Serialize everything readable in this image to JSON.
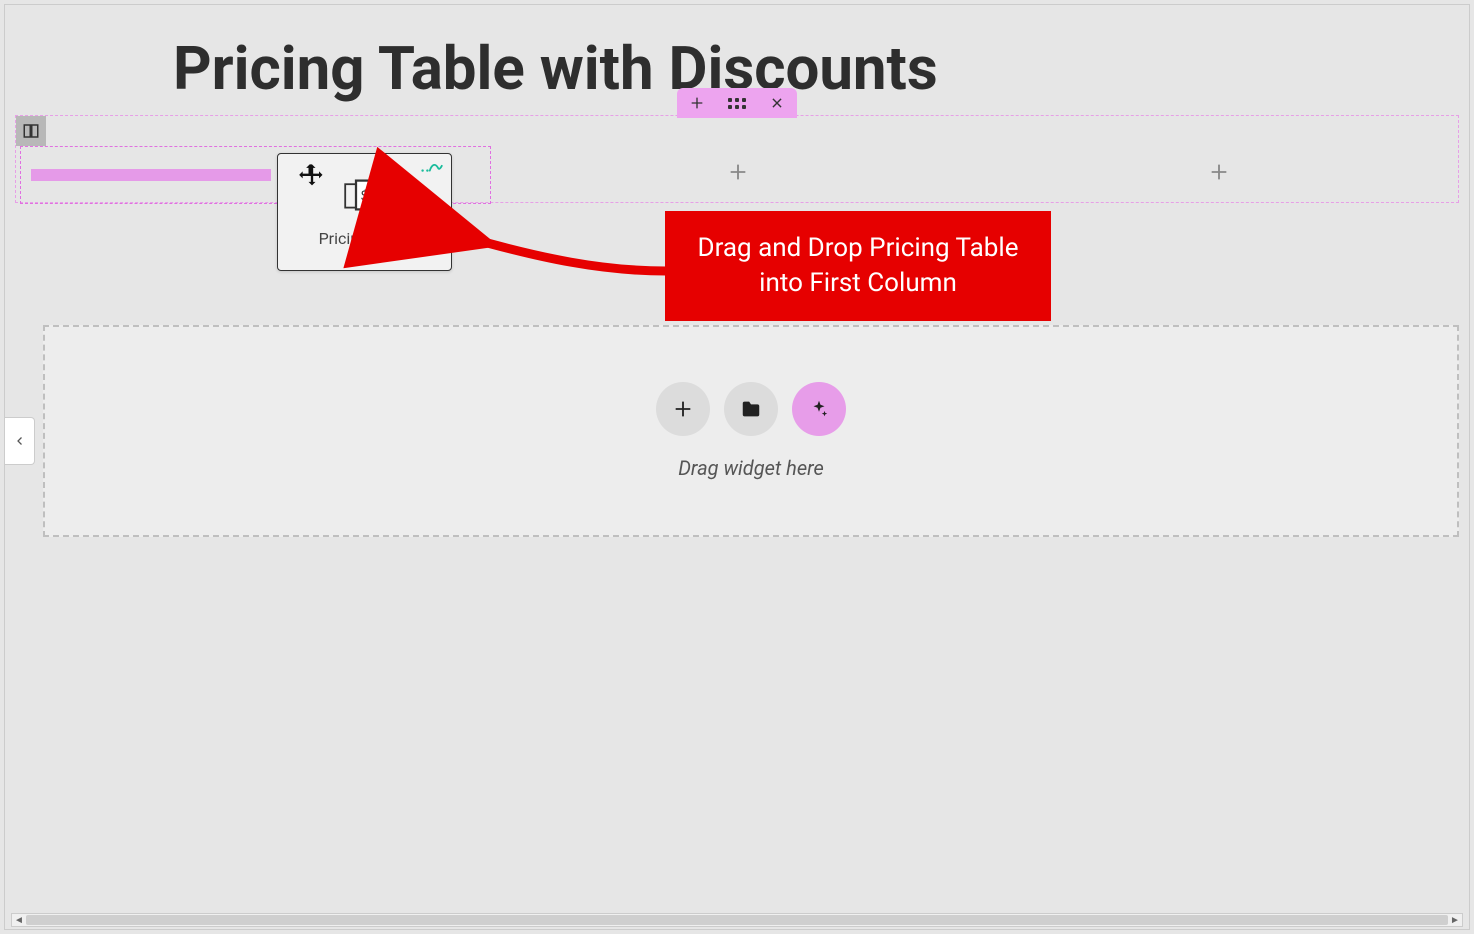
{
  "page": {
    "title": "Pricing Table with Discounts"
  },
  "section_tab": {
    "add_tooltip": "Add section",
    "drag_tooltip": "Drag section",
    "delete_tooltip": "Delete section"
  },
  "widget_card": {
    "label": "Pricing Table"
  },
  "dropzone": {
    "hint": "Drag widget here"
  },
  "callout": {
    "text": "Drag and Drop Pricing Table into First Column"
  }
}
